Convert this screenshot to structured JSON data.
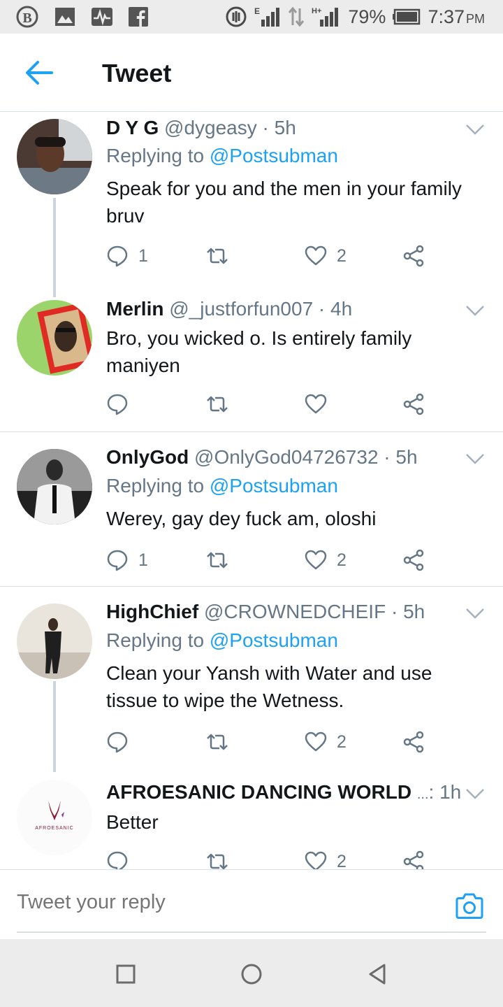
{
  "status_bar": {
    "icons": [
      "b-badge-icon",
      "image-icon",
      "pulse-app-icon",
      "facebook-icon",
      "data-saver-icon",
      "signal-e-icon",
      "data-arrows-icon",
      "signal-hplus-icon",
      "battery-icon"
    ],
    "battery": "79%",
    "time": "7:37",
    "time_suffix": "PM"
  },
  "header": {
    "title": "Tweet"
  },
  "colors": {
    "accent": "#1da1f2",
    "muted": "#657786",
    "text": "#14171a",
    "divider": "#d8dfe5"
  },
  "tweets": [
    {
      "name": "D Y G",
      "handle": "@dygeasy",
      "sep": " · ",
      "time": "5h",
      "replying_prefix": "Replying to ",
      "replying_to": "@Postsubman",
      "text": "Speak for you and the men in your family bruv",
      "replies": "1",
      "retweets": "",
      "likes": "2"
    },
    {
      "name": "Merlin",
      "handle": "@_justforfun007",
      "sep": " · ",
      "time": "4h",
      "text": "Bro, you wicked o. Is entirely family maniyen",
      "replies": "",
      "retweets": "",
      "likes": ""
    },
    {
      "name": "OnlyGod",
      "handle": "@OnlyGod04726732",
      "sep": " · ",
      "time": "5h",
      "replying_prefix": "Replying to ",
      "replying_to": "@Postsubman",
      "text": "Werey, gay dey fuck am, oloshi",
      "replies": "1",
      "retweets": "",
      "likes": "2"
    },
    {
      "name": "HighChief",
      "handle": "@CROWNEDCHEIF",
      "sep": " · ",
      "time": "5h",
      "replying_prefix": "Replying to ",
      "replying_to": "@Postsubman",
      "text": "Clean your Yansh with Water and  use tissue to wipe the Wetness.",
      "replies": "",
      "retweets": "",
      "likes": "2"
    },
    {
      "name": "AFROESANIC DANCING WORLD",
      "handle": "...",
      "sep": ": ",
      "time": "1h",
      "text": "Better",
      "replies": "",
      "retweets": "",
      "likes": "2",
      "avatar_logo_text": "AFROESANIC"
    }
  ],
  "reply_bar": {
    "placeholder": "Tweet your reply"
  },
  "nav": {
    "buttons": [
      "recents-square-icon",
      "home-circle-icon",
      "back-triangle-icon"
    ]
  }
}
